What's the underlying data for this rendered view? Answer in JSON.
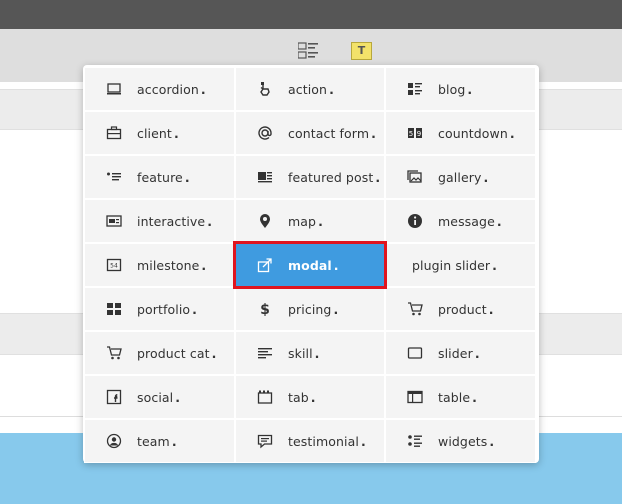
{
  "toolbar": {
    "text_button_label": "T",
    "highlight_color": "#f3e26a"
  },
  "popup": {
    "accent_color": "#3f9be0",
    "selection_outline_color": "#e0141e",
    "items": [
      {
        "label": "accordion",
        "icon": "accordion-icon"
      },
      {
        "label": "action",
        "icon": "action-icon"
      },
      {
        "label": "blog",
        "icon": "blog-icon"
      },
      {
        "label": "client",
        "icon": "client-icon"
      },
      {
        "label": "contact form",
        "icon": "contact-form-icon"
      },
      {
        "label": "countdown",
        "icon": "countdown-icon"
      },
      {
        "label": "feature",
        "icon": "feature-icon"
      },
      {
        "label": "featured post",
        "icon": "featured-post-icon"
      },
      {
        "label": "gallery",
        "icon": "gallery-icon"
      },
      {
        "label": "interactive",
        "icon": "interactive-icon"
      },
      {
        "label": "map",
        "icon": "map-icon"
      },
      {
        "label": "message",
        "icon": "message-icon"
      },
      {
        "label": "milestone",
        "icon": "milestone-icon"
      },
      {
        "label": "modal",
        "icon": "modal-icon",
        "selected": true
      },
      {
        "label": "plugin slider",
        "icon": ""
      },
      {
        "label": "portfolio",
        "icon": "portfolio-icon"
      },
      {
        "label": "pricing",
        "icon": "pricing-icon"
      },
      {
        "label": "product",
        "icon": "product-icon"
      },
      {
        "label": "product cat",
        "icon": "product-cat-icon"
      },
      {
        "label": "skill",
        "icon": "skill-icon"
      },
      {
        "label": "slider",
        "icon": "slider-icon"
      },
      {
        "label": "social",
        "icon": "social-icon"
      },
      {
        "label": "tab",
        "icon": "tab-icon"
      },
      {
        "label": "table",
        "icon": "table-icon"
      },
      {
        "label": "team",
        "icon": "team-icon"
      },
      {
        "label": "testimonial",
        "icon": "testimonial-icon"
      },
      {
        "label": "widgets",
        "icon": "widgets-icon"
      }
    ]
  }
}
